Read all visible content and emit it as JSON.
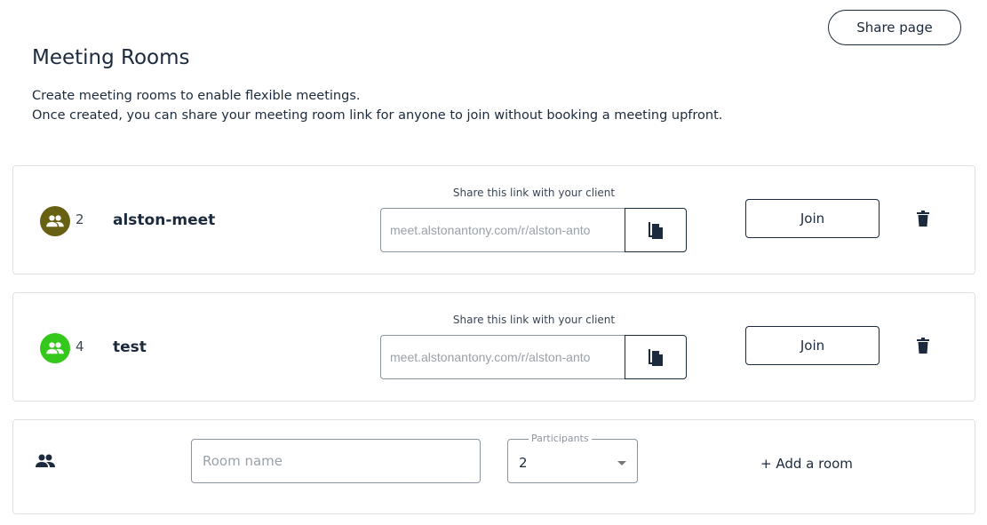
{
  "header": {
    "share_page": "Share page",
    "title": "Meeting Rooms",
    "desc_line1": "Create meeting rooms to enable flexible meetings.",
    "desc_line2": "Once created, you can share your meeting room link for anyone to join without booking a meeting upfront."
  },
  "rooms": [
    {
      "name": "alston-meet",
      "participants": "2",
      "color": "#686013",
      "link_label": "Share this link with your client",
      "link": "meet.alstonantony.com/r/alston-anto",
      "join": "Join"
    },
    {
      "name": "test",
      "participants": "4",
      "color": "#35c81c",
      "link_label": "Share this link with your client",
      "link": "meet.alstonantony.com/r/alston-anto",
      "join": "Join"
    }
  ],
  "new_room": {
    "name_placeholder": "Room name",
    "participants_label": "Participants",
    "participants_value": "2",
    "add": "+ Add a room"
  },
  "icons": {
    "avatar": "people-icon",
    "copy": "copy-icon",
    "delete": "trash-icon"
  }
}
